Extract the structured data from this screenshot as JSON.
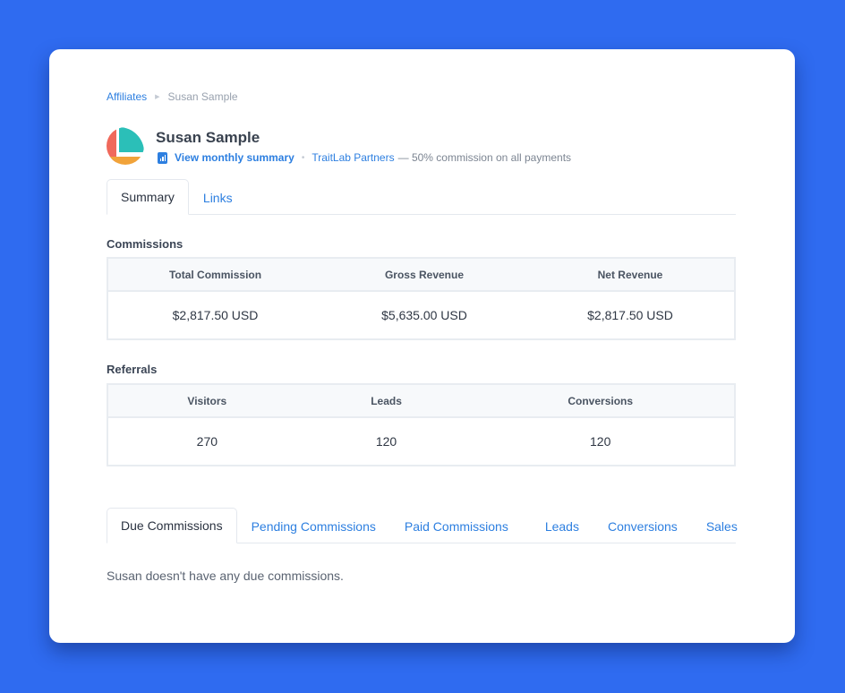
{
  "colors": {
    "background": "#2f6bf0",
    "accent": "#2d7fe0",
    "avatar": [
      "#2bbfb8",
      "#f0695b",
      "#f1a33a"
    ]
  },
  "breadcrumb": {
    "parent": "Affiliates",
    "separator_icon": "chevron-right-icon",
    "current": "Susan Sample"
  },
  "affiliate": {
    "name": "Susan Sample",
    "avatar_icon": "avatar-logo-icon",
    "summary_icon": "report-chart-icon",
    "summary_link": "View monthly summary",
    "separator": "•",
    "program": "TraitLab Partners",
    "program_desc": "— 50% commission on all payments"
  },
  "top_tabs": [
    {
      "label": "Summary",
      "active": true
    },
    {
      "label": "Links",
      "active": false
    }
  ],
  "commissions": {
    "title": "Commissions",
    "headers": [
      "Total Commission",
      "Gross Revenue",
      "Net Revenue"
    ],
    "values": [
      "$2,817.50 USD",
      "$5,635.00 USD",
      "$2,817.50 USD"
    ]
  },
  "referrals": {
    "title": "Referrals",
    "headers": [
      "Visitors",
      "Leads",
      "Conversions"
    ],
    "values": [
      "270",
      "120",
      "120"
    ]
  },
  "bottom_tabs": [
    {
      "label": "Due Commissions",
      "active": true
    },
    {
      "label": "Pending Commissions",
      "active": false
    },
    {
      "label": "Paid Commissions",
      "active": false
    },
    {
      "label": "Leads",
      "active": false
    },
    {
      "label": "Conversions",
      "active": false
    },
    {
      "label": "Sales",
      "active": false
    }
  ],
  "empty_message": "Susan doesn't have any due commissions."
}
